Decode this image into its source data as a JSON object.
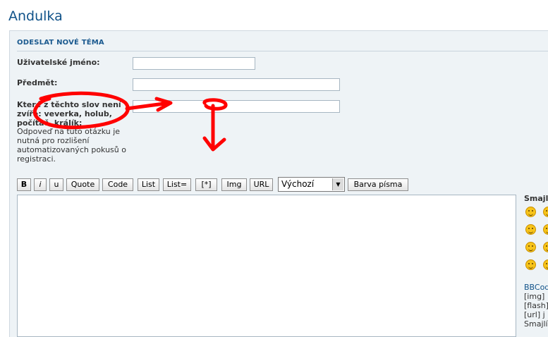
{
  "site": {
    "title": "Andulka"
  },
  "form": {
    "header": "ODESLAT NOVÉ TÉMA",
    "username_label": "Uživatelské jméno:",
    "username_value": "",
    "subject_label": "Předmět:",
    "subject_value": "",
    "question_label_line1": "Které z těchto slov není",
    "question_label_line2": "zvíře: veverka, holub,",
    "question_label_line3": "počítač, králík:",
    "question_explain": "Odpoveď na tuto otázku je nutná pro rozlišení automatizovaných pokusů o registraci.",
    "question_value": ""
  },
  "toolbar": {
    "bold": "B",
    "italic": "i",
    "underline": "u",
    "quote": "Quote",
    "code": "Code",
    "list": "List",
    "list_eq": "List=",
    "list_item": "[*]",
    "img": "Img",
    "url": "URL",
    "font_size_selected": "Výchozí",
    "font_color": "Barva písma"
  },
  "editor": {
    "value": ""
  },
  "sidebar": {
    "smileys_title": "Smajlí",
    "bbcode_link": "BBCod",
    "line_img": "[img]",
    "line_flash": "[flash]",
    "line_url": "[url] j",
    "line_smilies": "Smajlí"
  },
  "colors": {
    "accent": "#105289",
    "panel_bg": "#eef3f6",
    "scribble": "#ff0000"
  }
}
